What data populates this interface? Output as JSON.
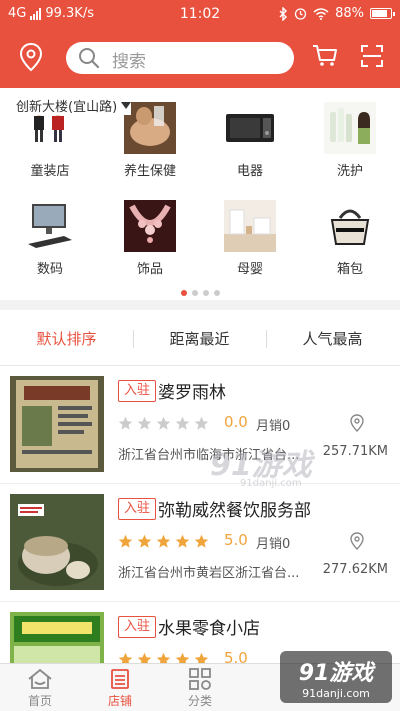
{
  "status_bar": {
    "network": "4G",
    "speed": "99.3K/s",
    "time": "11:02",
    "battery": "88%"
  },
  "header": {
    "search_placeholder": "搜索"
  },
  "location": {
    "label": "创新大楼(宜山路)"
  },
  "categories": [
    {
      "label": "童装店",
      "icon": "kids-clothing-photo"
    },
    {
      "label": "养生保健",
      "icon": "wellness-photo"
    },
    {
      "label": "电器",
      "icon": "microwave-photo"
    },
    {
      "label": "洗护",
      "icon": "cosmetics-photo"
    },
    {
      "label": "数码",
      "icon": "computer-photo"
    },
    {
      "label": "饰品",
      "icon": "necklace-photo"
    },
    {
      "label": "母婴",
      "icon": "baby-room-photo"
    },
    {
      "label": "箱包",
      "icon": "handbag-photo"
    }
  ],
  "carousel": {
    "pages": 4,
    "current": 1
  },
  "sort_tabs": [
    {
      "label": "默认排序",
      "active": true
    },
    {
      "label": "距离最近",
      "active": false
    },
    {
      "label": "人气最高",
      "active": false
    }
  ],
  "stores": [
    {
      "tag": "入驻",
      "name": "婆罗雨林",
      "rating": 0.0,
      "score": "0.0",
      "sales": "月销0",
      "address": "浙江省台州市临海市浙江省台...",
      "distance": "257.71KM"
    },
    {
      "tag": "入驻",
      "name": "弥勒威然餐饮服务部",
      "rating": 5.0,
      "score": "5.0",
      "sales": "月销0",
      "address": "浙江省台州市黄岩区浙江省台...",
      "distance": "277.62KM"
    },
    {
      "tag": "入驻",
      "name": "水果零食小店",
      "rating": 5.0,
      "score": "5.0",
      "sales": "",
      "address": "",
      "distance": ""
    }
  ],
  "tab_bar": [
    {
      "label": "首页",
      "icon": "home-icon",
      "active": false
    },
    {
      "label": "店铺",
      "icon": "store-icon",
      "active": true
    },
    {
      "label": "分类",
      "icon": "category-icon",
      "active": false
    }
  ],
  "watermark": {
    "logo": "91游戏",
    "site": "91danji.com"
  },
  "colors": {
    "brand": "#e9513f",
    "star": "#f0a43c",
    "star_empty": "#cccccc"
  }
}
